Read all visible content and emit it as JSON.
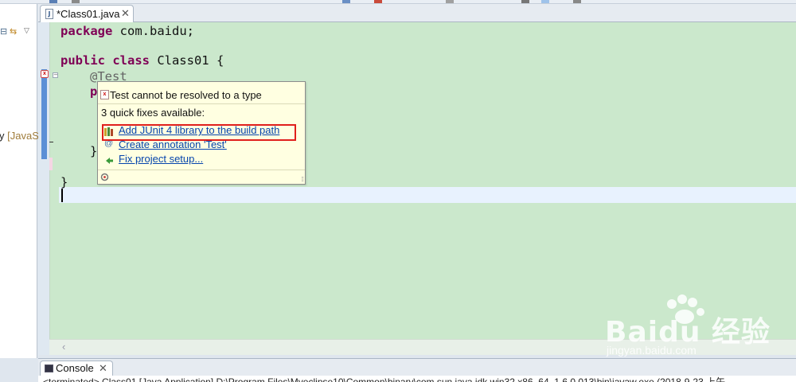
{
  "editor_tab": {
    "label": "*Class01.java",
    "close": "✕",
    "file_icon": "J"
  },
  "left_panel": {
    "text_a": "y",
    "text_b": "[JavaS"
  },
  "code": {
    "line1": "package com.baidu;",
    "line2_kw": "public class",
    "line2_rest": " Class01 {",
    "line3": "@Test",
    "line4": "p",
    "line5": "}",
    "line6": "}"
  },
  "quick_fix": {
    "title": "Test cannot be resolved to a type",
    "subtitle": "3 quick fixes available:",
    "fixes": [
      {
        "label": "Add JUnit 4 library to the build path",
        "icon": "library-icon"
      },
      {
        "label": "Create annotation 'Test'",
        "icon": "annotation-icon"
      },
      {
        "label": "Fix project setup...",
        "icon": "fix-setup-icon"
      }
    ],
    "highlight_color": "#e0201c"
  },
  "console": {
    "label": "Console",
    "close": "✕",
    "text": "<terminated> Class01 [Java Application] D:\\Program Files\\Myeclipse10\\Common\\binary\\com.sun.java.jdk.win32.x86_64_1.6.0.013\\bin\\javaw.exe (2018-9-23 上午"
  },
  "watermark": {
    "logo": "Baidu 经验",
    "sub": "jingyan.baidu.com"
  },
  "colors": {
    "editor_bg": "#cbe8cc",
    "keyword": "#7f0055",
    "link": "#0645ad",
    "popup_bg": "#ffffe1"
  }
}
